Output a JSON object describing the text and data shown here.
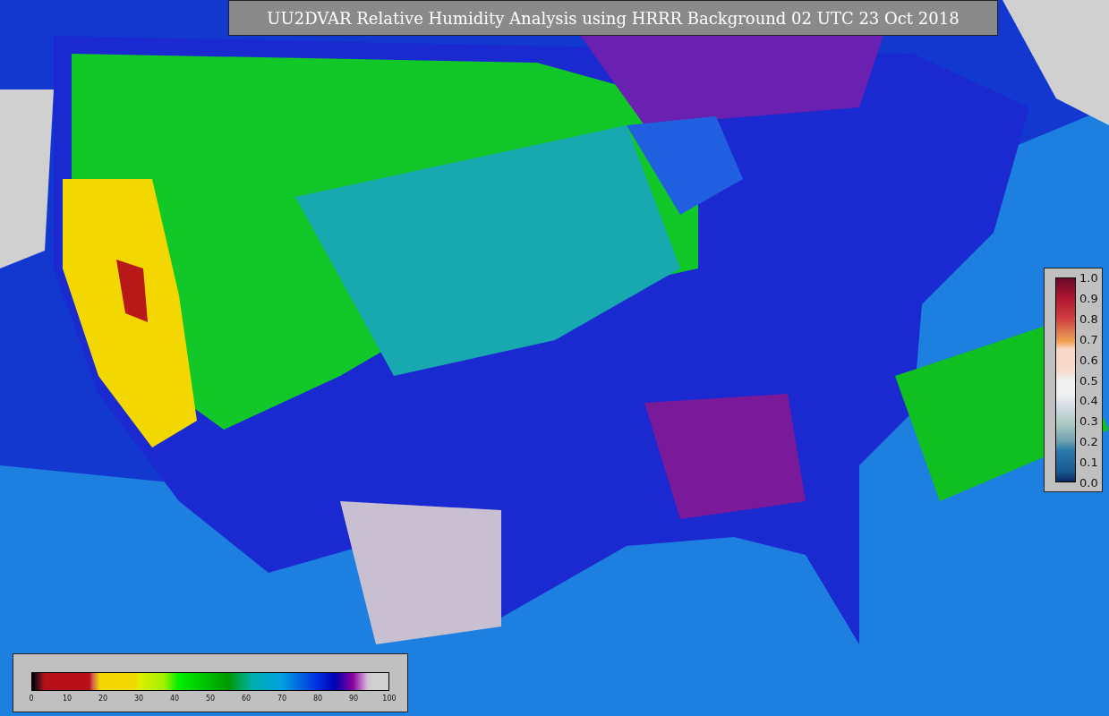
{
  "title": "UU2DVAR Relative Humidity Analysis using HRRR Background 02 UTC 23 Oct 2018",
  "horizontal_colorbar": {
    "ticks": [
      "0",
      "10",
      "20",
      "30",
      "40",
      "50",
      "60",
      "70",
      "80",
      "90",
      "100"
    ]
  },
  "vertical_colorbar": {
    "ticks": [
      "1.0",
      "0.9",
      "0.8",
      "0.7",
      "0.6",
      "0.5",
      "0.4",
      "0.3",
      "0.2",
      "0.1",
      "0.0"
    ]
  }
}
